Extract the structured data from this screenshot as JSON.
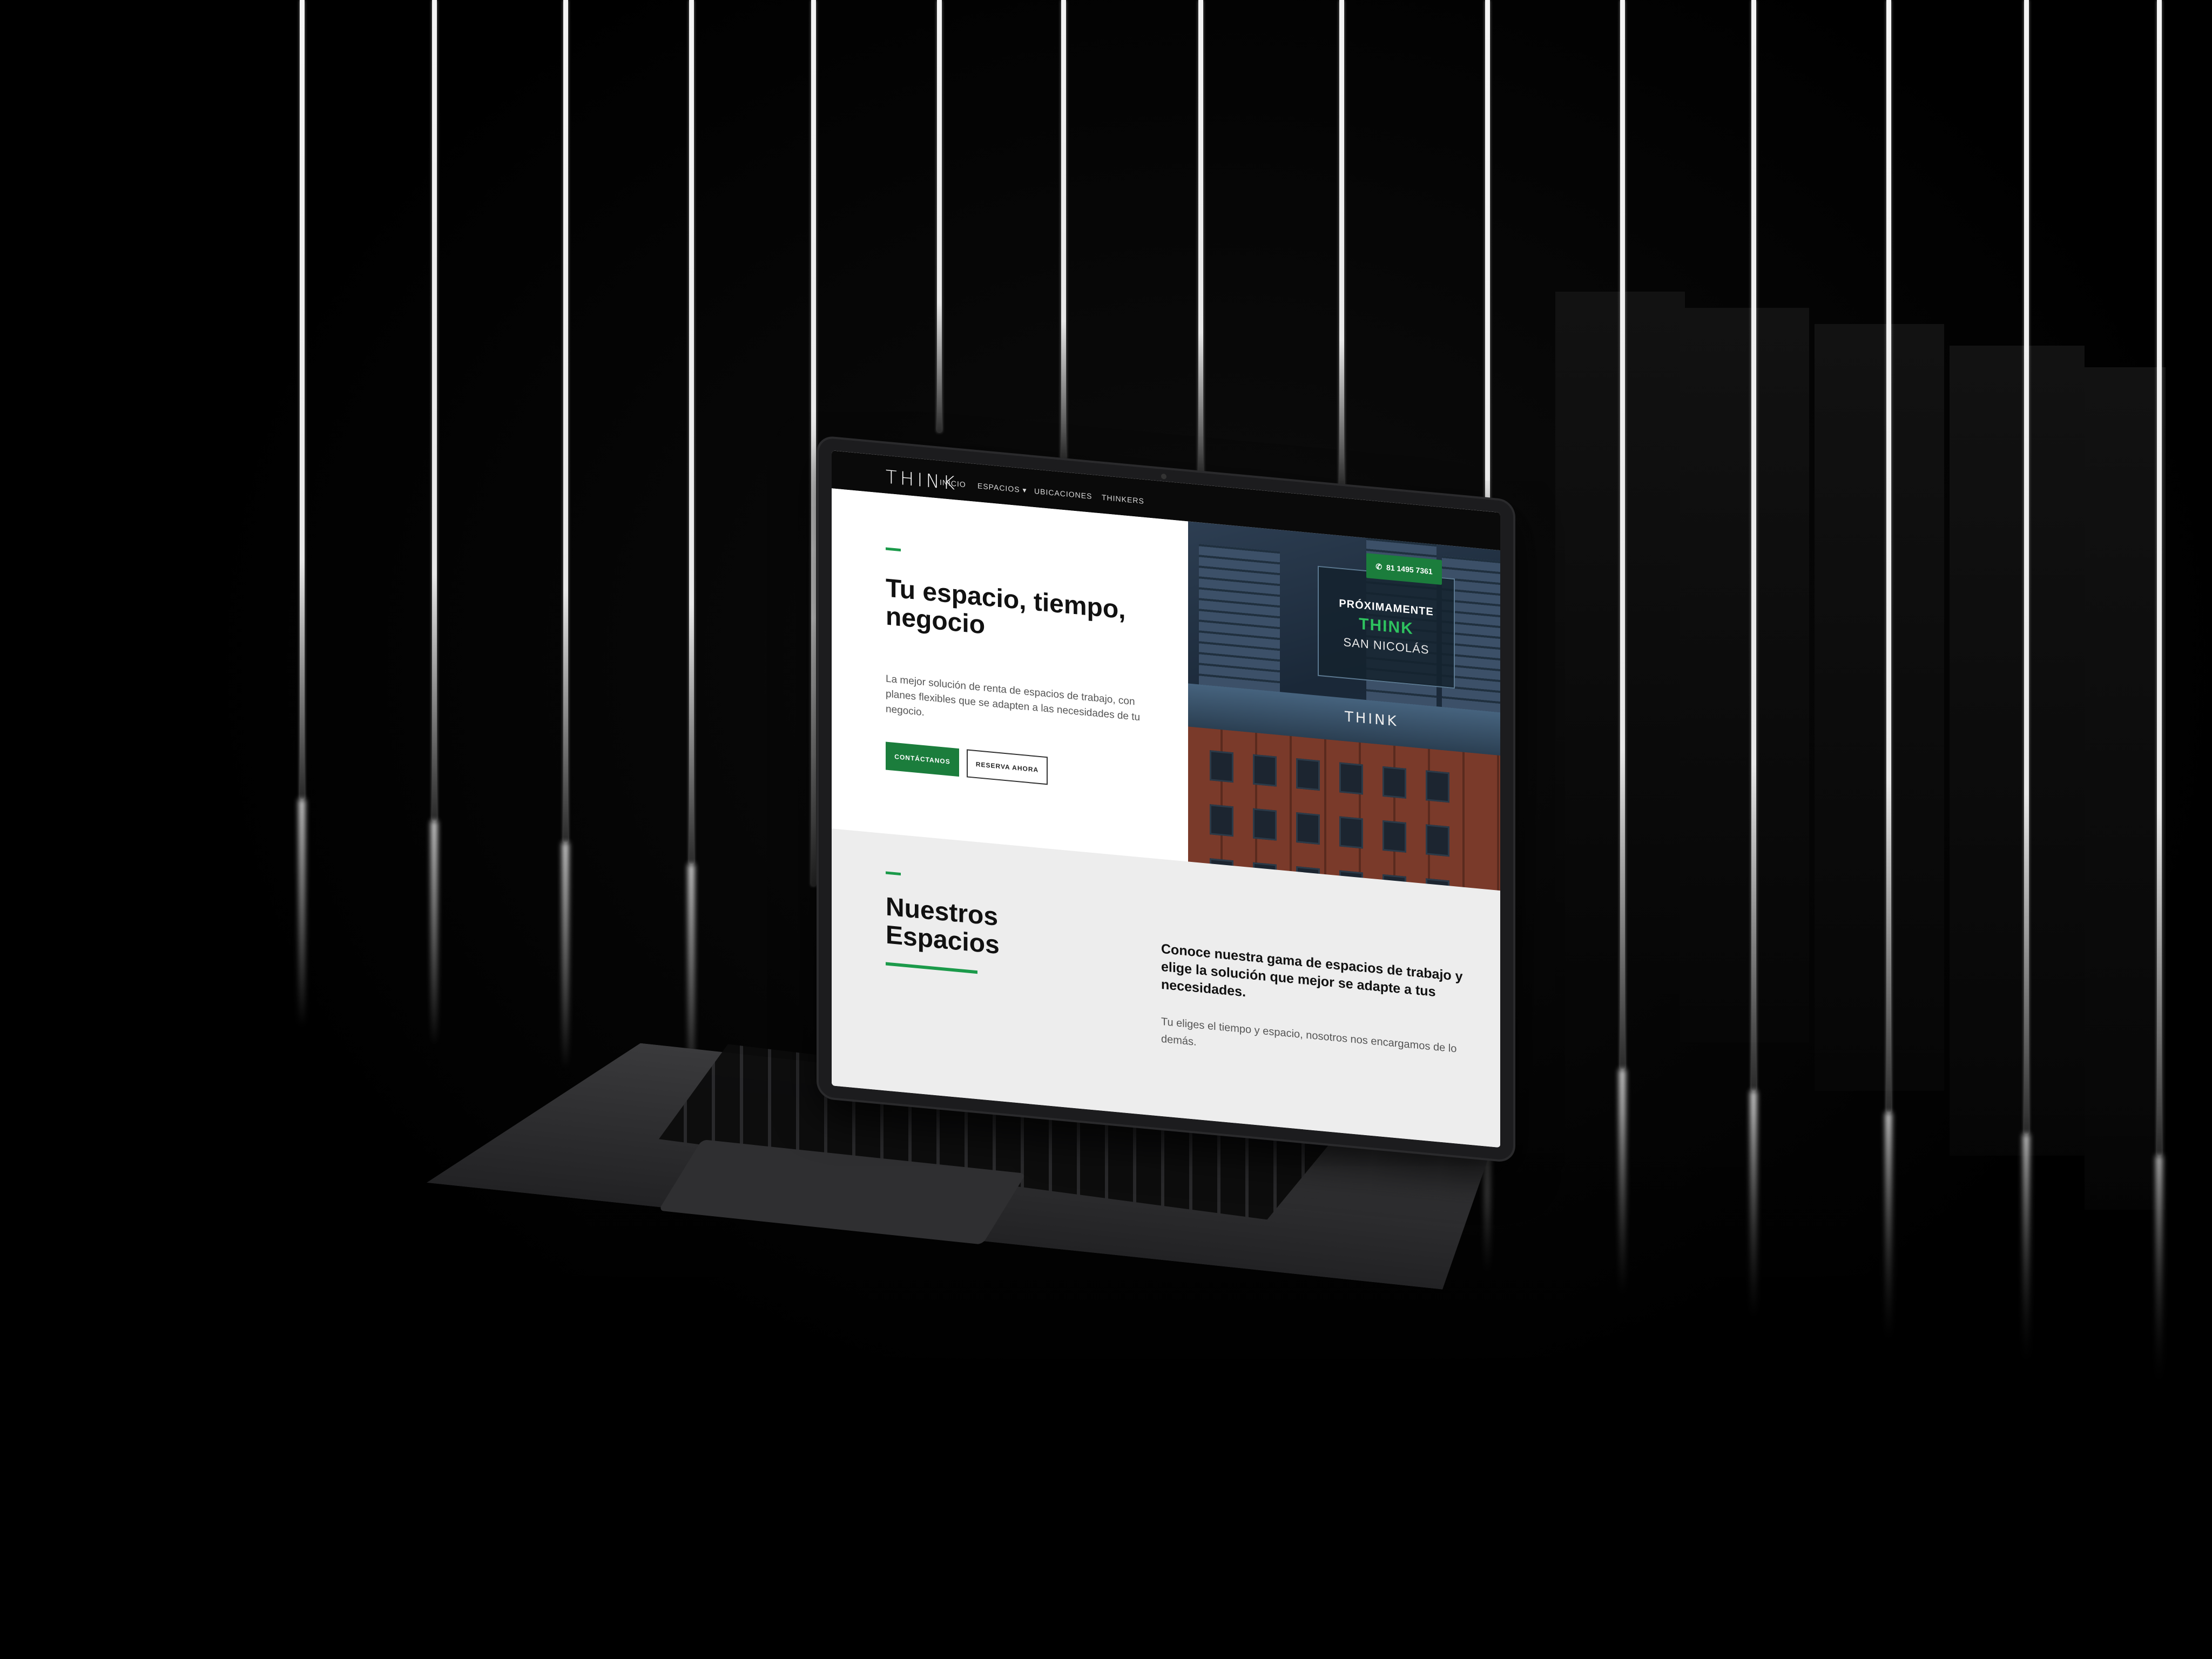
{
  "site": {
    "logo_text": "THINK",
    "accent_color": "#1b7d3c",
    "nav": {
      "items": [
        "INICIO",
        "ESPACIOS",
        "UBICACIONES",
        "THINKERS"
      ],
      "phone_label": "81 1495 7361",
      "phone_icon": "whatsapp-icon"
    },
    "hero": {
      "title": "Tu espacio, tiempo, negocio",
      "subtitle": "La mejor solución de renta de espacios de trabajo, con planes flexibles que se adapten a las necesidades de tu negocio.",
      "primary_button": "CONTÁCTANOS",
      "secondary_button": "RESERVA AHORA"
    },
    "hero_image": {
      "billboard_line1": "PRÓXIMAMENTE",
      "billboard_line2": "THINK",
      "billboard_line3": "SAN NICOLÁS",
      "building_sign": "THINK"
    },
    "espacios": {
      "title": "Nuestros Espacios",
      "heading": "Conoce nuestra gama de espacios de trabajo y elige la solución que mejor se adapte a tus necesidades.",
      "body": "Tu eliges el tiempo y espacio, nosotros nos encargamos de lo demás."
    }
  }
}
